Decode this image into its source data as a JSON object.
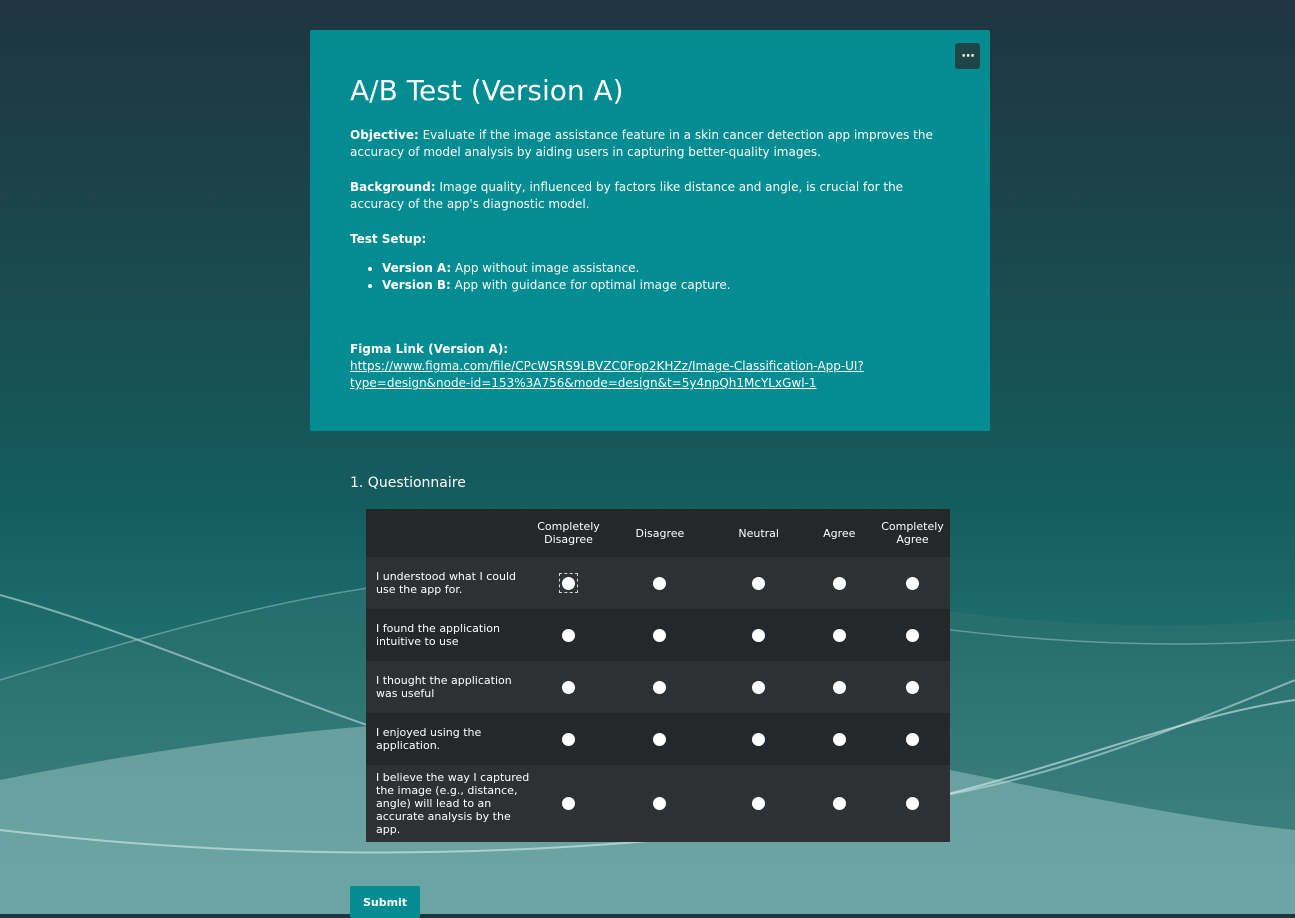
{
  "form": {
    "title": "A/B Test (Version A)",
    "more_icon": "⋯",
    "objective_label": "Objective:",
    "objective_text": " Evaluate if the image assistance feature in a skin cancer detection app improves the accuracy of model analysis by aiding users in capturing better-quality images.",
    "background_label": "Background:",
    "background_text": " Image quality, influenced by factors like distance and angle, is crucial for the accuracy of the app's diagnostic model.",
    "setup_label": "Test Setup:",
    "versions": [
      {
        "label": "Version A:",
        "text": " App without image assistance."
      },
      {
        "label": "Version B:",
        "text": " App with guidance for optimal image capture."
      }
    ],
    "figma_label": "Figma Link (Version A):",
    "figma_url": "https://www.figma.com/file/CPcWSRS9LBVZC0Fop2KHZz/Image-Classification-App-UI?type=design&node-id=153%3A756&mode=design&t=5y4npQh1McYLxGwl-1"
  },
  "question": {
    "title": "1. Questionnaire",
    "columns": [
      "Completely Disagree",
      "Disagree",
      "Neutral",
      "Agree",
      "Completely Agree"
    ],
    "rows": [
      "I understood what I could use the app for.",
      "I found the application intuitive to use",
      "I thought the application was useful",
      "I enjoyed using the application.",
      "I believe the way I captured the image (e.g., distance, angle) will lead to an accurate analysis by the app."
    ]
  },
  "submit_label": "Submit",
  "colors": {
    "accent": "#038c91",
    "grid_dark": "#25282b",
    "grid_light": "#2e3133"
  }
}
